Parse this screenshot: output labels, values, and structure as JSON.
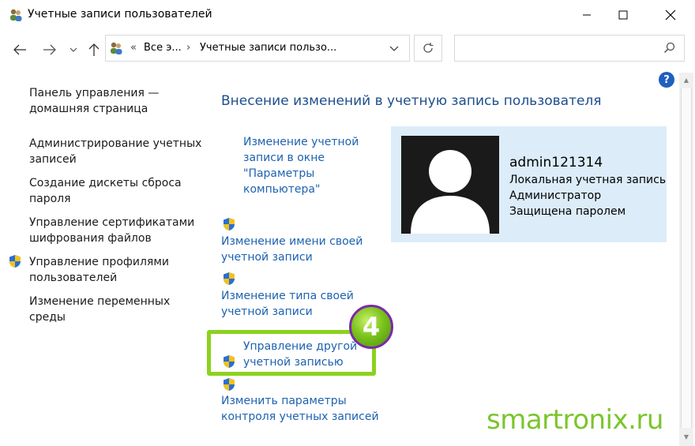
{
  "window": {
    "title": "Учетные записи пользователей"
  },
  "address": {
    "sep": "«",
    "crumb1": "Все э...",
    "arrow": "›",
    "crumb2": "Учетные записи пользо..."
  },
  "search": {
    "placeholder": ""
  },
  "help_label": "?",
  "left_pane": {
    "home": "Панель управления — домашняя страница",
    "items": [
      "Администрирование учетных записей",
      "Создание дискеты сброса пароля",
      "Управление сертификатами шифрования файлов",
      "Управление профилями пользователей",
      "Изменение переменных среды"
    ]
  },
  "main": {
    "title": "Внесение изменений в учетную запись пользователя",
    "links": [
      "Изменение учетной записи в окне \"Параметры компьютера\"",
      "Изменение имени своей учетной записи",
      "Изменение типа своей учетной записи",
      "Управление другой учетной записью",
      "Изменить параметры контроля учетных записей"
    ]
  },
  "user": {
    "name": "admin121314",
    "lines": [
      "Локальная учетная запись",
      "Администратор",
      "Защищена паролем"
    ]
  },
  "overlay": {
    "step": "4",
    "watermark": "smartronix.ru"
  },
  "colors": {
    "link": "#1e62b0",
    "title": "#1e4e8c",
    "card": "#dcecf9",
    "highlight": "#8cd21e",
    "watermark": "#7bc52c"
  }
}
